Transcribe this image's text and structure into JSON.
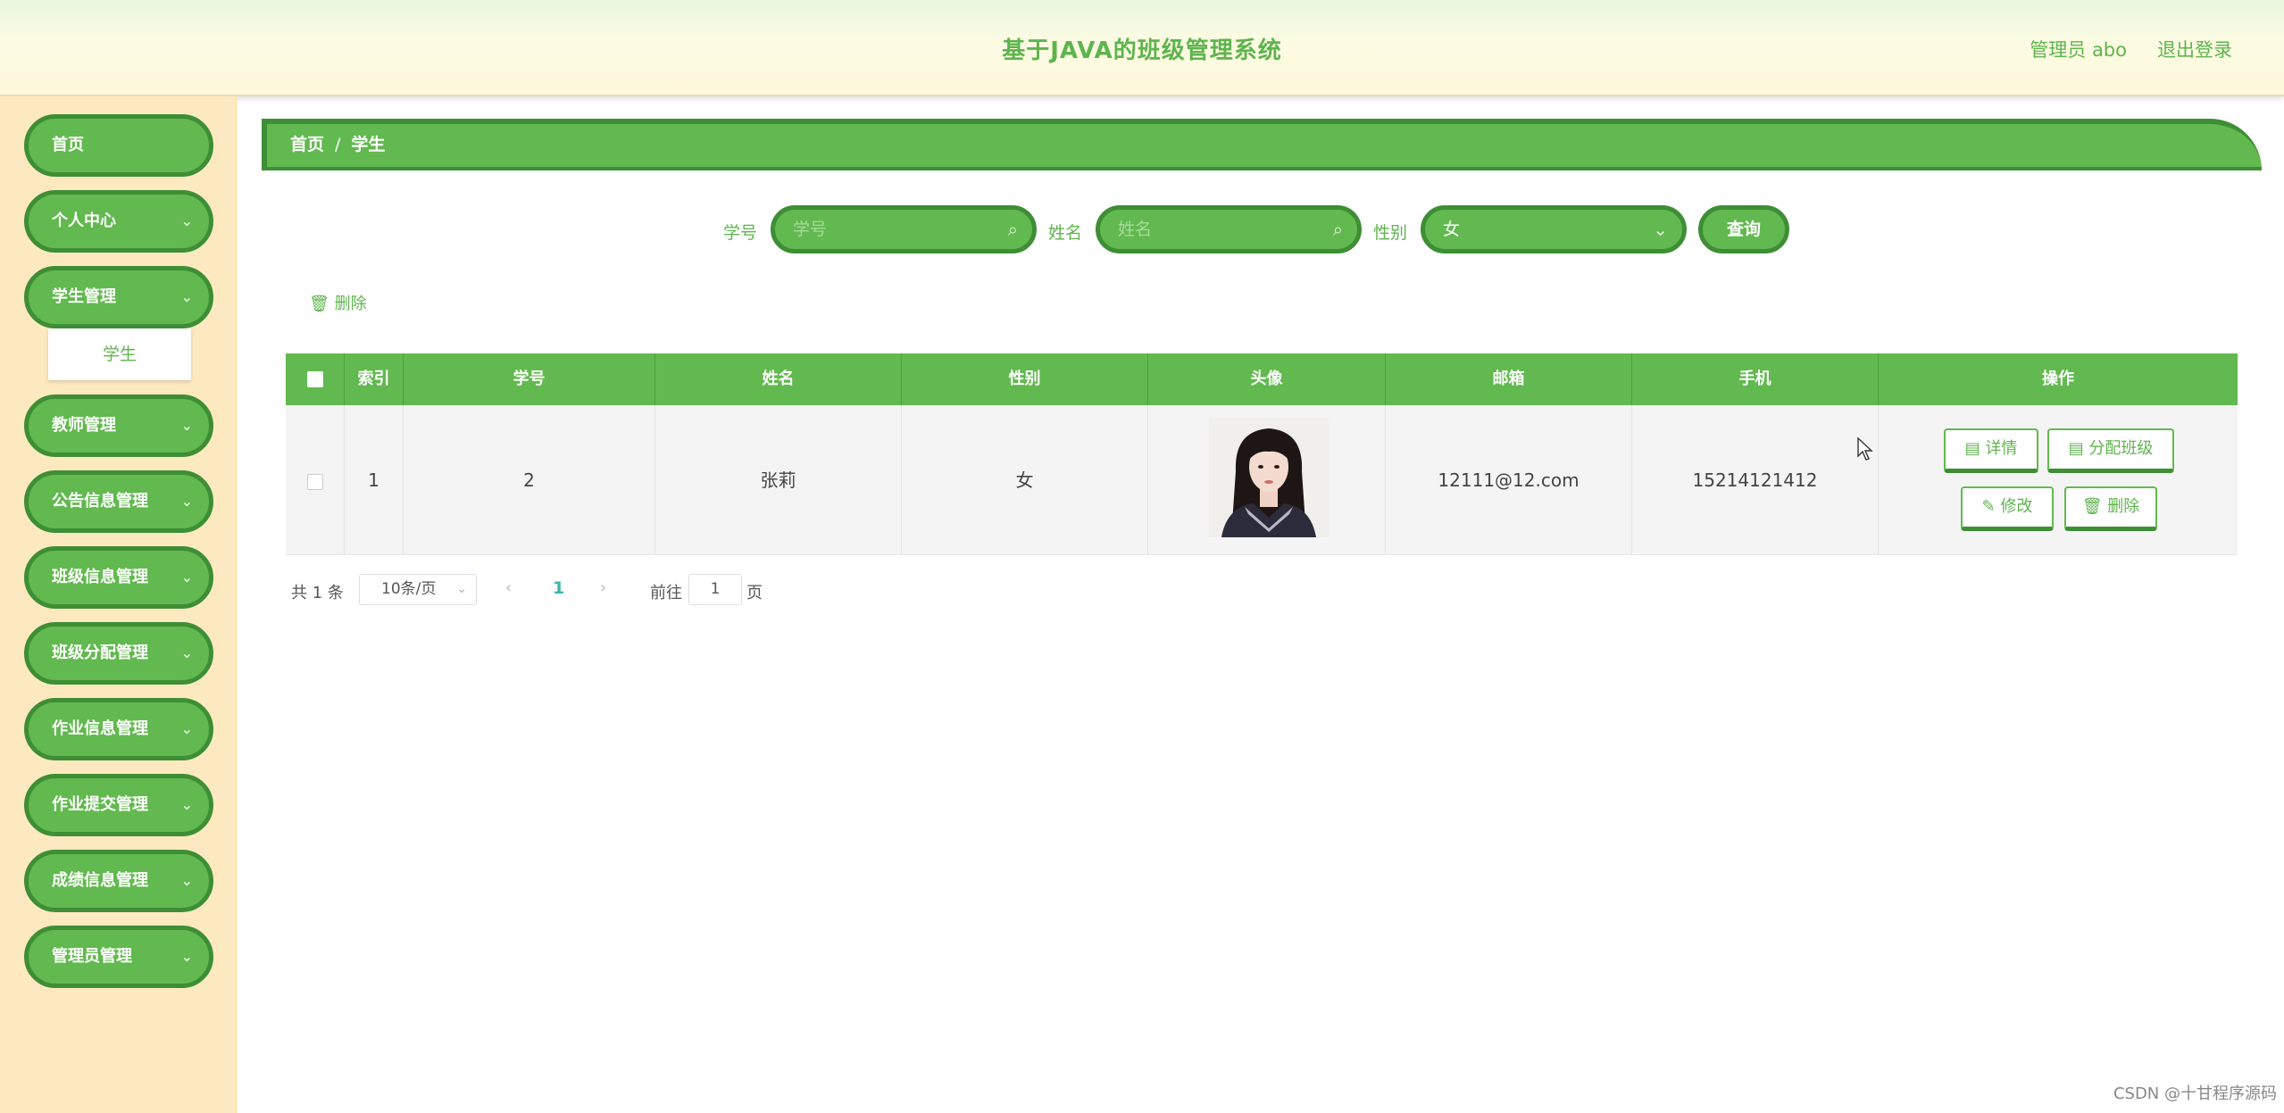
{
  "header": {
    "title": "基于JAVA的班级管理系统",
    "admin_label": "管理员 abo",
    "logout_label": "退出登录"
  },
  "sidebar": {
    "items": [
      {
        "label": "首页",
        "has_chevron": false
      },
      {
        "label": "个人中心",
        "has_chevron": true
      },
      {
        "label": "学生管理",
        "has_chevron": true
      },
      {
        "label": "教师管理",
        "has_chevron": true
      },
      {
        "label": "公告信息管理",
        "has_chevron": true
      },
      {
        "label": "班级信息管理",
        "has_chevron": true
      },
      {
        "label": "班级分配管理",
        "has_chevron": true
      },
      {
        "label": "作业信息管理",
        "has_chevron": true
      },
      {
        "label": "作业提交管理",
        "has_chevron": true
      },
      {
        "label": "成绩信息管理",
        "has_chevron": true
      },
      {
        "label": "管理员管理",
        "has_chevron": true
      }
    ],
    "submenu_item": "学生",
    "chevron": "⌄"
  },
  "breadcrumb": {
    "home": "首页",
    "separator": "/",
    "current": "学生"
  },
  "search": {
    "student_no_label": "学号",
    "student_no_placeholder": "学号",
    "name_label": "姓名",
    "name_placeholder": "姓名",
    "gender_label": "性别",
    "gender_value": "女",
    "query_button": "查询"
  },
  "toolbar": {
    "delete_label": "删除"
  },
  "table": {
    "headers": [
      "",
      "索引",
      "学号",
      "姓名",
      "性别",
      "头像",
      "邮箱",
      "手机",
      "操作"
    ],
    "rows": [
      {
        "index": "1",
        "student_no": "2",
        "name": "张莉",
        "gender": "女",
        "email": "12111@12.com",
        "phone": "15214121412"
      }
    ],
    "actions": {
      "detail": "详情",
      "assign_class": "分配班级",
      "edit": "修改",
      "delete": "删除"
    }
  },
  "pagination": {
    "total": "共 1 条",
    "page_size": "10条/页",
    "current_page": "1",
    "goto_label": "前往",
    "goto_value": "1",
    "page_suffix": "页"
  },
  "watermark": "CSDN @十甘程序源码",
  "colors": {
    "primary_green": "#62b94f",
    "dark_green": "#3e8e36",
    "sidebar_bg": "#fde9bf"
  }
}
